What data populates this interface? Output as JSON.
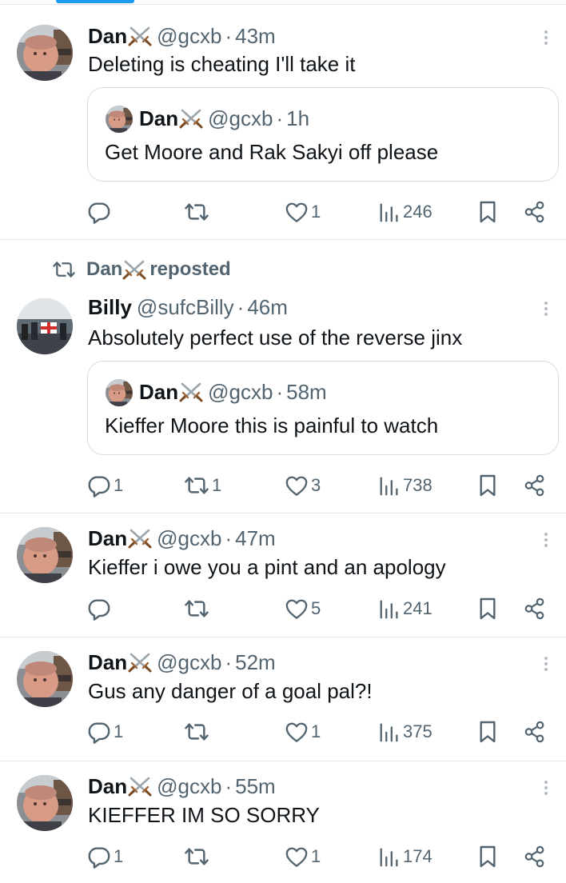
{
  "colors": {
    "accent": "#1d9bf0",
    "secondary_text": "#536471",
    "divider": "#e3e8ec"
  },
  "icons": [
    "reply-icon",
    "repost-icon",
    "like-icon",
    "views-icon",
    "bookmark-icon",
    "share-icon",
    "more-icon",
    "crossed-swords-icon"
  ],
  "tweets": [
    {
      "name": "Dan",
      "handle": "@gcxb",
      "time": "43m",
      "text": "Deleting is cheating I'll take it",
      "quote": {
        "name": "Dan",
        "handle": "@gcxb",
        "time": "1h",
        "text": "Get Moore and Rak Sakyi off please"
      },
      "replies": "",
      "reposts": "",
      "likes": "1",
      "views": "246"
    },
    {
      "reposted_by": "Dan",
      "reposted_label": "reposted",
      "name": "Billy",
      "handle": "@sufcBilly",
      "time": "46m",
      "text": "Absolutely perfect use of the reverse jinx",
      "quote": {
        "name": "Dan",
        "handle": "@gcxb",
        "time": "58m",
        "text": "Kieffer Moore this is painful to watch"
      },
      "replies": "1",
      "reposts": "1",
      "likes": "3",
      "views": "738"
    },
    {
      "name": "Dan",
      "handle": "@gcxb",
      "time": "47m",
      "text": "Kieffer i owe you a pint and an apology",
      "replies": "",
      "reposts": "",
      "likes": "5",
      "views": "241"
    },
    {
      "name": "Dan",
      "handle": "@gcxb",
      "time": "52m",
      "text": "Gus any danger of a goal pal?!",
      "replies": "1",
      "reposts": "",
      "likes": "1",
      "views": "375"
    },
    {
      "name": "Dan",
      "handle": "@gcxb",
      "time": "55m",
      "text": "KIEFFER IM SO SORRY",
      "replies": "1",
      "reposts": "",
      "likes": "1",
      "views": "174"
    }
  ]
}
